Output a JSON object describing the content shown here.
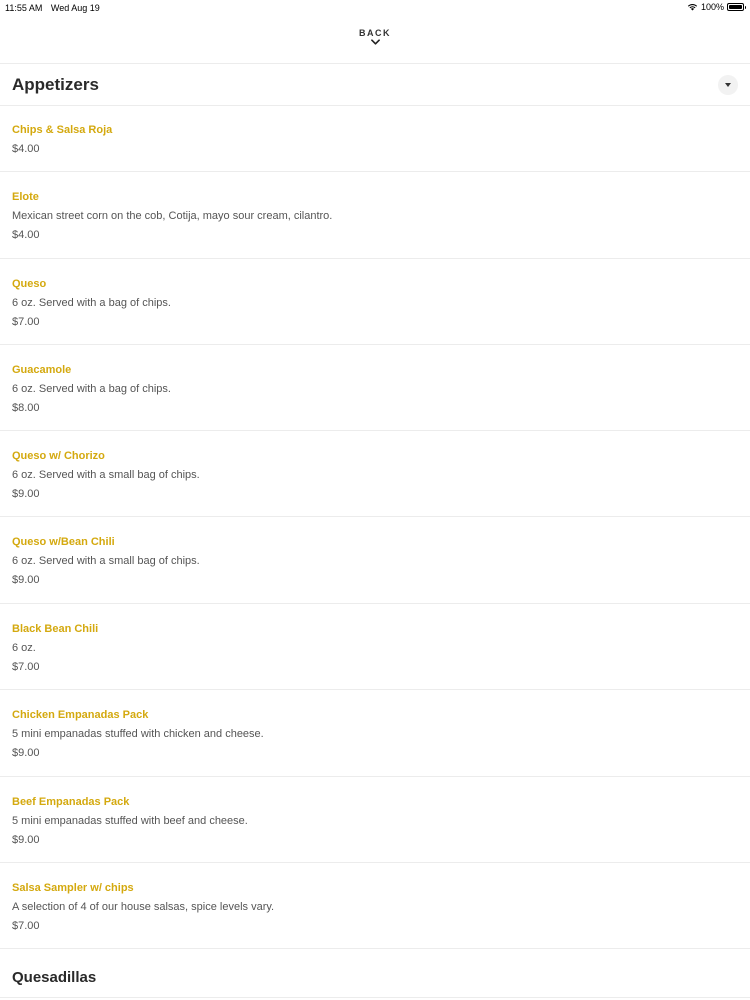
{
  "status": {
    "time": "11:55 AM",
    "date": "Wed Aug 19",
    "battery": "100%"
  },
  "nav": {
    "back_label": "BACK"
  },
  "sections": [
    {
      "title": "Appetizers",
      "items": [
        {
          "name": "Chips & Salsa Roja",
          "desc": "",
          "price": "$4.00"
        },
        {
          "name": "Elote",
          "desc": "Mexican street corn on the cob, Cotija, mayo sour cream, cilantro.",
          "price": "$4.00"
        },
        {
          "name": "Queso",
          "desc": "6 oz. Served with a bag of chips.",
          "price": "$7.00"
        },
        {
          "name": "Guacamole",
          "desc": "6 oz. Served with a bag of chips.",
          "price": "$8.00"
        },
        {
          "name": "Queso w/ Chorizo",
          "desc": "6 oz. Served with a small bag of chips.",
          "price": "$9.00"
        },
        {
          "name": "Queso w/Bean Chili",
          "desc": "6 oz. Served with a small bag of chips.",
          "price": "$9.00"
        },
        {
          "name": "Black Bean Chili",
          "desc": "6 oz.",
          "price": "$7.00"
        },
        {
          "name": "Chicken Empanadas Pack",
          "desc": "5 mini empanadas stuffed with chicken and cheese.",
          "price": "$9.00"
        },
        {
          "name": "Beef Empanadas Pack",
          "desc": "5 mini empanadas stuffed with beef and cheese.",
          "price": "$9.00"
        },
        {
          "name": "Salsa Sampler w/ chips",
          "desc": "A selection of 4 of our house salsas, spice levels vary.",
          "price": "$7.00"
        }
      ]
    },
    {
      "title": "Quesadillas",
      "items": []
    }
  ],
  "colors": {
    "accent": "#d4a90f",
    "divider": "#ececec",
    "text": "#333333"
  }
}
